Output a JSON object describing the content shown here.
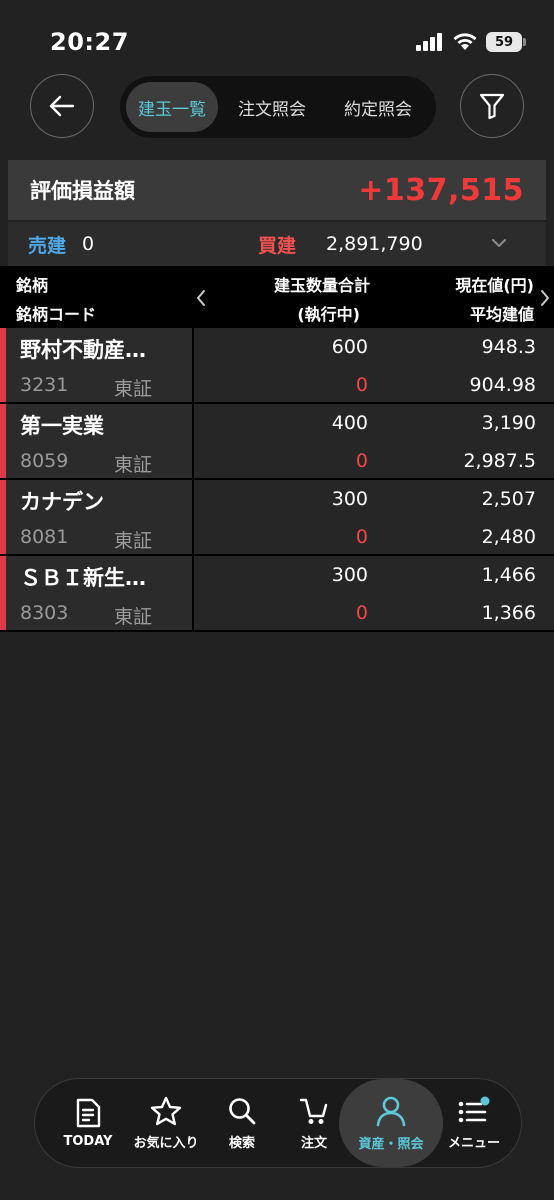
{
  "status_bar": {
    "time": "20:27",
    "battery": "59"
  },
  "header": {
    "tabs": [
      {
        "label": "建玉一覧",
        "active": true
      },
      {
        "label": "注文照会",
        "active": false
      },
      {
        "label": "約定照会",
        "active": false
      }
    ]
  },
  "summary": {
    "pl_label": "評価損益額",
    "pl_value": "+137,515",
    "sell_label": "売建",
    "sell_value": "0",
    "buy_label": "買建",
    "buy_value": "2,891,790"
  },
  "table": {
    "headers": {
      "name": "銘柄",
      "code": "銘柄コード",
      "qty": "建玉数量合計",
      "pending": "(執行中)",
      "price": "現在値(円)",
      "avg": "平均建値"
    },
    "rows": [
      {
        "name": "野村不動産…",
        "code": "3231",
        "market": "東証",
        "qty": "600",
        "pending": "0",
        "price": "948.3",
        "avg": "904.98"
      },
      {
        "name": "第一実業",
        "code": "8059",
        "market": "東証",
        "qty": "400",
        "pending": "0",
        "price": "3,190",
        "avg": "2,987.5"
      },
      {
        "name": "カナデン",
        "code": "8081",
        "market": "東証",
        "qty": "300",
        "pending": "0",
        "price": "2,507",
        "avg": "2,480"
      },
      {
        "name": "ＳＢＩ新生…",
        "code": "8303",
        "market": "東証",
        "qty": "300",
        "pending": "0",
        "price": "1,466",
        "avg": "1,366"
      }
    ]
  },
  "bottom_nav": {
    "items": [
      {
        "label": "TODAY",
        "icon": "document-icon"
      },
      {
        "label": "お気に入り",
        "icon": "star-icon"
      },
      {
        "label": "検索",
        "icon": "search-icon"
      },
      {
        "label": "注文",
        "icon": "order-icon"
      },
      {
        "label": "資産・照会",
        "icon": "person-icon",
        "active": true
      },
      {
        "label": "メニュー",
        "icon": "list-icon"
      }
    ]
  },
  "colors": {
    "accent": "#5cc8d8",
    "profit": "#f03a3a",
    "sell": "#4fa8e8",
    "buy": "#f05050"
  }
}
